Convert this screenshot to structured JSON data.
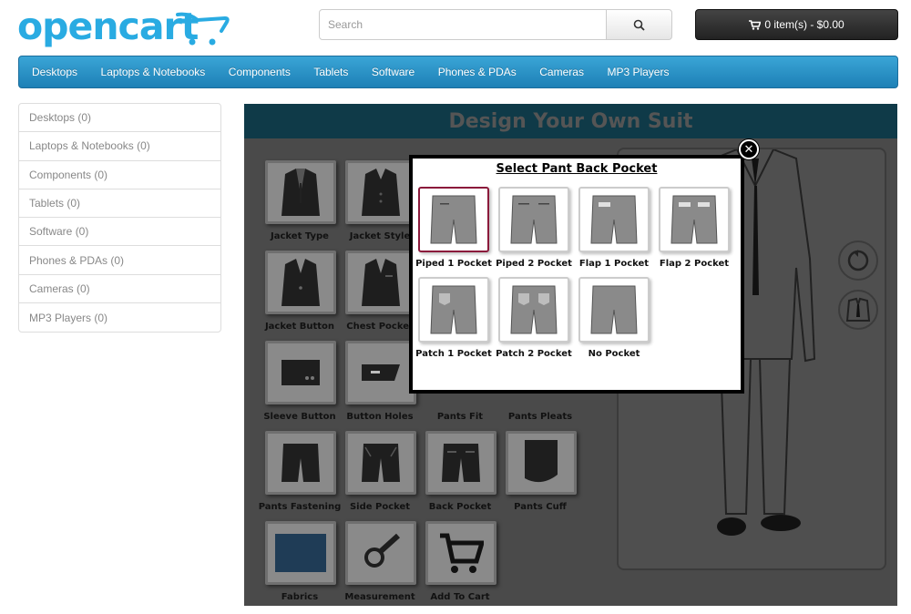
{
  "header": {
    "logo_text": "opencart",
    "search_placeholder": "Search",
    "cart_label": "0 item(s) - $0.00"
  },
  "nav": {
    "items": [
      "Desktops",
      "Laptops & Notebooks",
      "Components",
      "Tablets",
      "Software",
      "Phones & PDAs",
      "Cameras",
      "MP3 Players"
    ]
  },
  "sidebar": {
    "items": [
      "Desktops (0)",
      "Laptops & Notebooks (0)",
      "Components (0)",
      "Tablets (0)",
      "Software (0)",
      "Phones & PDAs (0)",
      "Cameras (0)",
      "MP3 Players (0)"
    ]
  },
  "designer": {
    "title": "Design Your Own Suit",
    "options": {
      "jacket_type": "Jacket Type",
      "jacket_style": "Jacket Style",
      "jacket_button": "Jacket Button",
      "chest_pocket": "Chest Pocket",
      "sleeve_button": "Sleeve Button",
      "button_holes": "Button Holes",
      "pants_fit": "Pants Fit",
      "pants_pleats": "Pants Pleats",
      "pants_fastening": "Pants Fastening",
      "side_pocket": "Side Pocket",
      "back_pocket": "Back Pocket",
      "pants_cuff": "Pants Cuff",
      "fabrics": "Fabrics",
      "measurement": "Measurement",
      "add_to_cart": "Add To Cart"
    }
  },
  "modal": {
    "title": "Select Pant Back Pocket",
    "close_icon": "close-icon",
    "options": {
      "piped_1": "Piped 1 Pocket",
      "piped_2": "Piped 2 Pocket",
      "flap_1": "Flap 1 Pocket",
      "flap_2": "Flap 2 Pocket",
      "patch_1": "Patch 1 Pocket",
      "patch_2": "Patch 2 Pocket",
      "no_pocket": "No Pocket"
    },
    "selected": "Piped 1 Pocket"
  },
  "colors": {
    "brand": "#29abe2",
    "nav": "#229ad6",
    "selected_border": "#8b1a3b"
  }
}
